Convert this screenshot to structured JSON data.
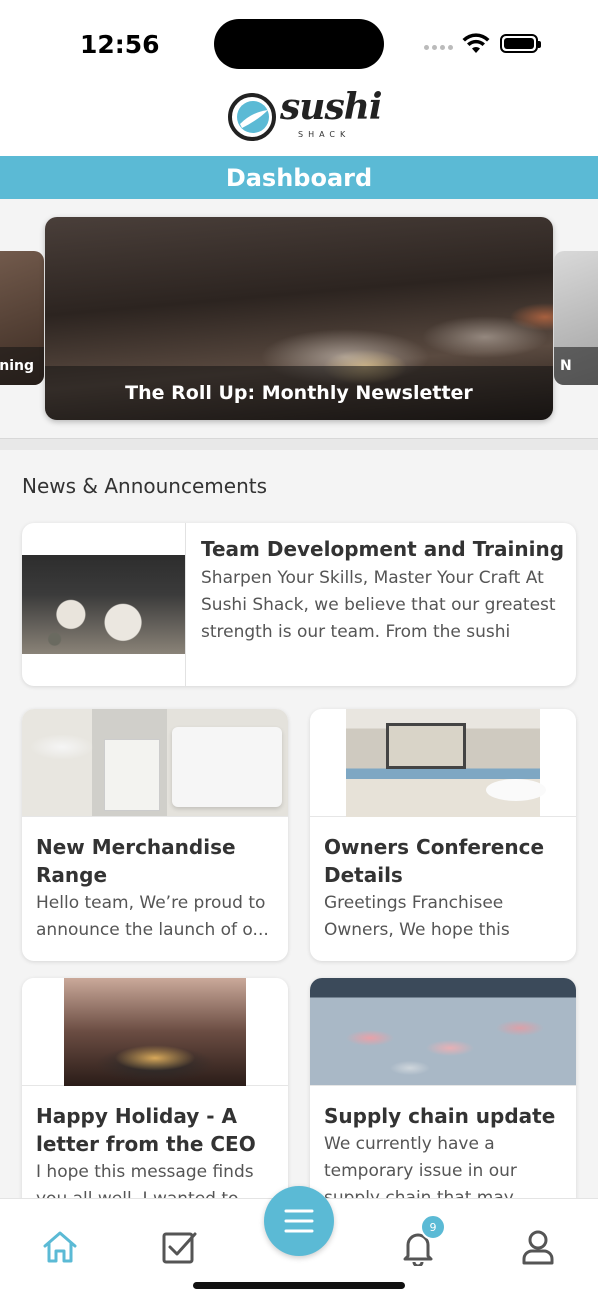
{
  "status_bar": {
    "time": "12:56"
  },
  "brand": {
    "name": "sushi",
    "sub": "SHACK",
    "accent": "#5bbad5",
    "logo_pink": "#d8357a"
  },
  "header": {
    "title": "Dashboard"
  },
  "carousel": {
    "left_caption": "ining",
    "main_caption": "The Roll Up: Monthly Newsletter",
    "right_caption": "N"
  },
  "news": {
    "section_title": "News & Announcements",
    "featured": {
      "title": "Team Development and Training",
      "body": "Sharpen Your Skills, Master Your Craft At Sushi Shack, we believe that our greatest strength is our team. From the sushi chefs..."
    },
    "cards": [
      {
        "title": "New Merchandise Range",
        "body": "Hello team, We’re proud to announce the launch of o..."
      },
      {
        "title": "Owners Conference Details",
        "body": "Greetings Franchisee Owners, We hope this mes..."
      },
      {
        "title": "Happy Holiday - A letter from the CEO",
        "body": "I hope this message finds you all well. I wanted to ta..."
      },
      {
        "title": "Supply chain update",
        "body": "We currently have a temporary issue in our supply chain that may affe..."
      }
    ]
  },
  "tabbar": {
    "items": [
      "home-icon",
      "checkbox-icon",
      "menu-icon",
      "bell-icon",
      "user-icon"
    ],
    "notification_count": "9"
  }
}
